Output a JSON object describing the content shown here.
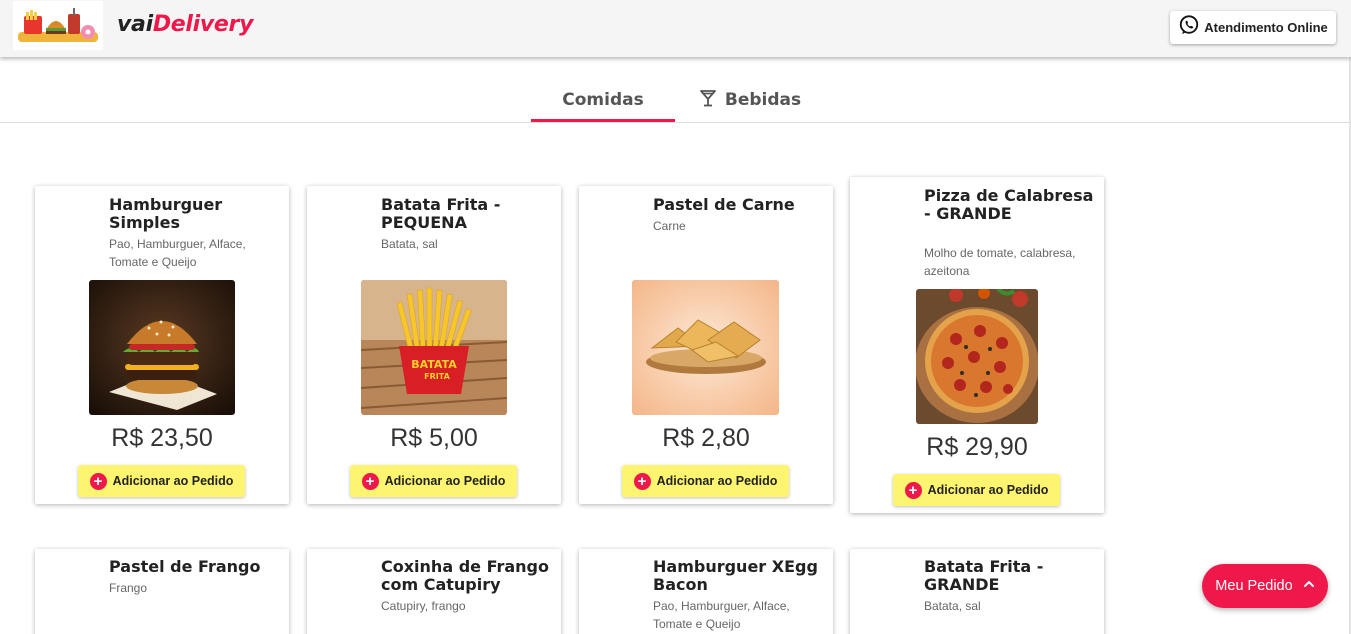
{
  "header": {
    "brand_prefix": "vai",
    "brand_name": "Delivery",
    "support_label": "Atendimento Online",
    "logo_icon": "fast-food-logo"
  },
  "tabs": [
    {
      "label": "Comidas",
      "active": true
    },
    {
      "label": "Bebidas",
      "icon": "cocktail-glass-icon",
      "active": false
    }
  ],
  "products": [
    {
      "name": "Hamburguer Simples",
      "description": "Pao, Hamburguer, Alface, Tomate e Queijo",
      "price": "R$ 23,50",
      "button": "Adicionar ao Pedido",
      "image": "burger-photo"
    },
    {
      "name": "Batata Frita - PEQUENA",
      "description": "Batata, sal",
      "price": "R$ 5,00",
      "button": "Adicionar ao Pedido",
      "image": "fries-photo",
      "image_text": "BATATA FRITA"
    },
    {
      "name": "Pastel de Carne",
      "description": "Carne",
      "price": "R$ 2,80",
      "button": "Adicionar ao Pedido",
      "image": "pastel-photo"
    },
    {
      "name": "Pizza de Calabresa - GRANDE",
      "description": "Molho de tomate, calabresa, azeitona",
      "price": "R$ 29,90",
      "button": "Adicionar ao Pedido",
      "image": "pizza-photo"
    },
    {
      "name": "Pastel de Frango",
      "description": "Frango"
    },
    {
      "name": "Coxinha de Frango com Catupiry",
      "description": "Catupiry, frango"
    },
    {
      "name": "Hamburguer XEgg Bacon",
      "description": "Pao, Hamburguer, Alface, Tomate e Queijo"
    },
    {
      "name": "Batata Frita - GRANDE",
      "description": "Batata, sal"
    }
  ],
  "order_button": {
    "label": "Meu Pedido",
    "icon": "chevron-up-icon"
  },
  "colors": {
    "accent": "#f0174a",
    "button_yellow": "#fdf56f",
    "header_bg": "#f5f5f5"
  }
}
